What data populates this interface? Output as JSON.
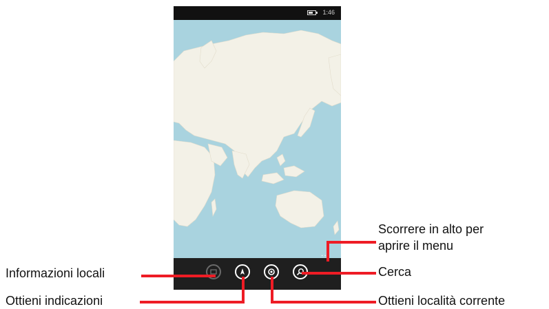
{
  "status_bar": {
    "time": "1:46",
    "battery_icon": "battery-icon"
  },
  "map": {
    "land_color": "#f3f1e7",
    "water_color": "#a9d3df"
  },
  "app_bar": {
    "buttons": [
      {
        "id": "local-info",
        "icon": "local-scout-icon"
      },
      {
        "id": "directions",
        "icon": "directions-icon"
      },
      {
        "id": "current-location",
        "icon": "location-target-icon"
      },
      {
        "id": "search",
        "icon": "search-icon"
      }
    ],
    "more": "..."
  },
  "callouts": {
    "local_info": "Informazioni locali",
    "directions": "Ottieni indicazioni",
    "menu_line1": "Scorrere in alto per",
    "menu_line2": "aprire il menu",
    "search": "Cerca",
    "current_location": "Ottieni località corrente"
  },
  "colors": {
    "callout_line": "#ee1c25",
    "app_bar": "#1f1f1f"
  }
}
